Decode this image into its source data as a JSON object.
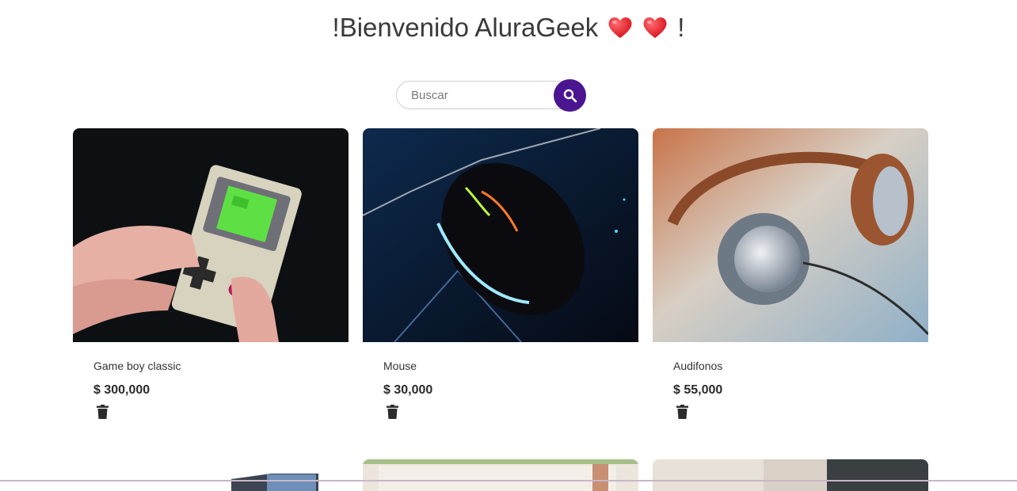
{
  "header": {
    "title_prefix": "!Bienvenido AluraGeek",
    "title_suffix": "!",
    "heart_icon": "red-heart-icon"
  },
  "search": {
    "placeholder": "Buscar",
    "value": "",
    "button_icon": "search-icon"
  },
  "colors": {
    "accent": "#4b1591",
    "text": "#333333",
    "heart": "#e8202b"
  },
  "products": [
    {
      "name": "Game boy classic",
      "price": "$ 300,000",
      "image": "gameboy-photo",
      "delete_icon": "trash-icon"
    },
    {
      "name": "Mouse",
      "price": "$ 30,000",
      "image": "gaming-mouse-photo",
      "delete_icon": "trash-icon"
    },
    {
      "name": "Audifonos",
      "price": "$ 55,000",
      "image": "headphones-photo",
      "delete_icon": "trash-icon"
    }
  ]
}
